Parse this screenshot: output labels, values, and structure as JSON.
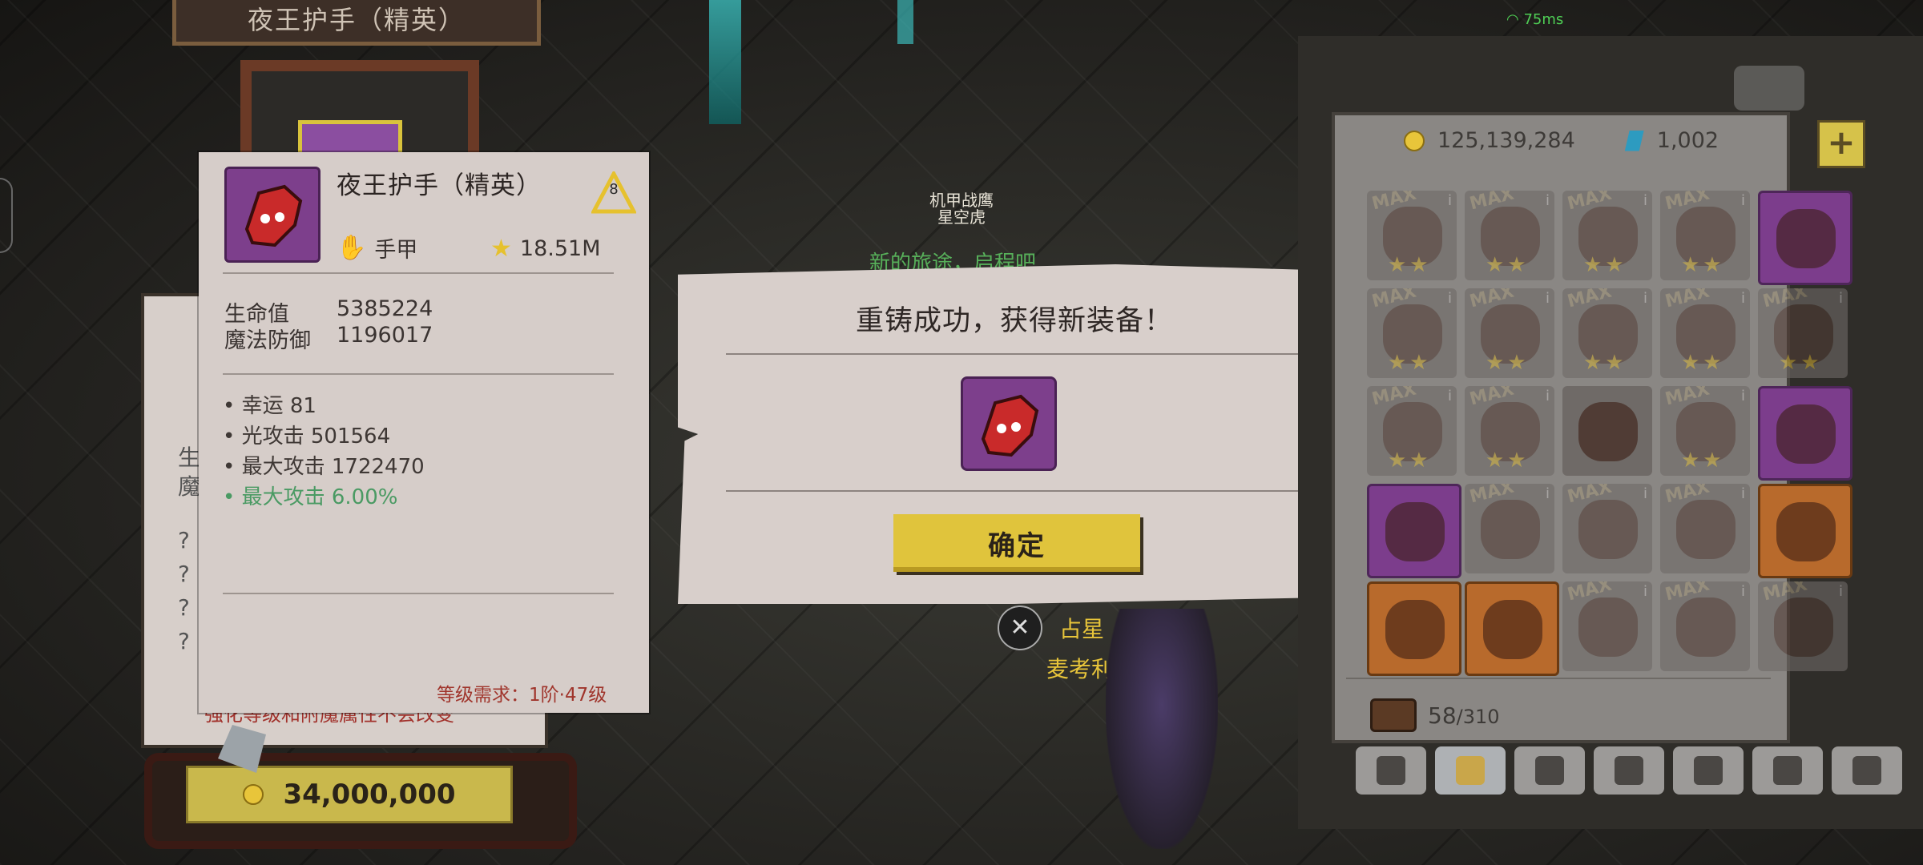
{
  "background": {
    "top_title": "夜王护手（精英）",
    "npc_guild": "机甲战鹰",
    "npc_name": "星空虎",
    "overhead_text": "新的旅途，启程吧",
    "ping": "75ms",
    "player_title": "占星",
    "player_name": "麦考利",
    "bg_panel_labels": [
      "生",
      "魔",
      "?",
      "?",
      "?",
      "?"
    ],
    "bg_warning": "强化等级和附魔属性不会改变",
    "price": "34,000,000"
  },
  "item_card": {
    "name": "夜王护手（精英）",
    "tier": "8",
    "type": "手甲",
    "power": "18.51M",
    "base_stats": [
      {
        "label": "生命值",
        "value": "5385224"
      },
      {
        "label": "魔法防御",
        "value": "1196017"
      }
    ],
    "attributes": [
      {
        "text": "幸运 81",
        "highlight": false
      },
      {
        "text": "光攻击 501564",
        "highlight": false
      },
      {
        "text": "最大攻击 1722470",
        "highlight": false
      },
      {
        "text": "最大攻击 6.00%",
        "highlight": true
      }
    ],
    "requirement": "等级需求：1阶·47级"
  },
  "dialog": {
    "title": "重铸成功，获得新装备！",
    "confirm_label": "确定"
  },
  "inventory": {
    "gold": "125,139,284",
    "gems": "1,002",
    "bag_used": "58",
    "bag_total": "/310",
    "max_label": "MAX",
    "info_label": "i",
    "tabs": [
      "toolbox",
      "gloves",
      "potion",
      "leaf",
      "feather",
      "swirl",
      "chest"
    ]
  },
  "colors": {
    "accent_yellow": "#e0c43c",
    "attribute_green": "#4a9a63",
    "requirement_red": "#a0352c",
    "epic_purple": "#7c3d8c",
    "legendary_orange": "#b86a2c"
  }
}
